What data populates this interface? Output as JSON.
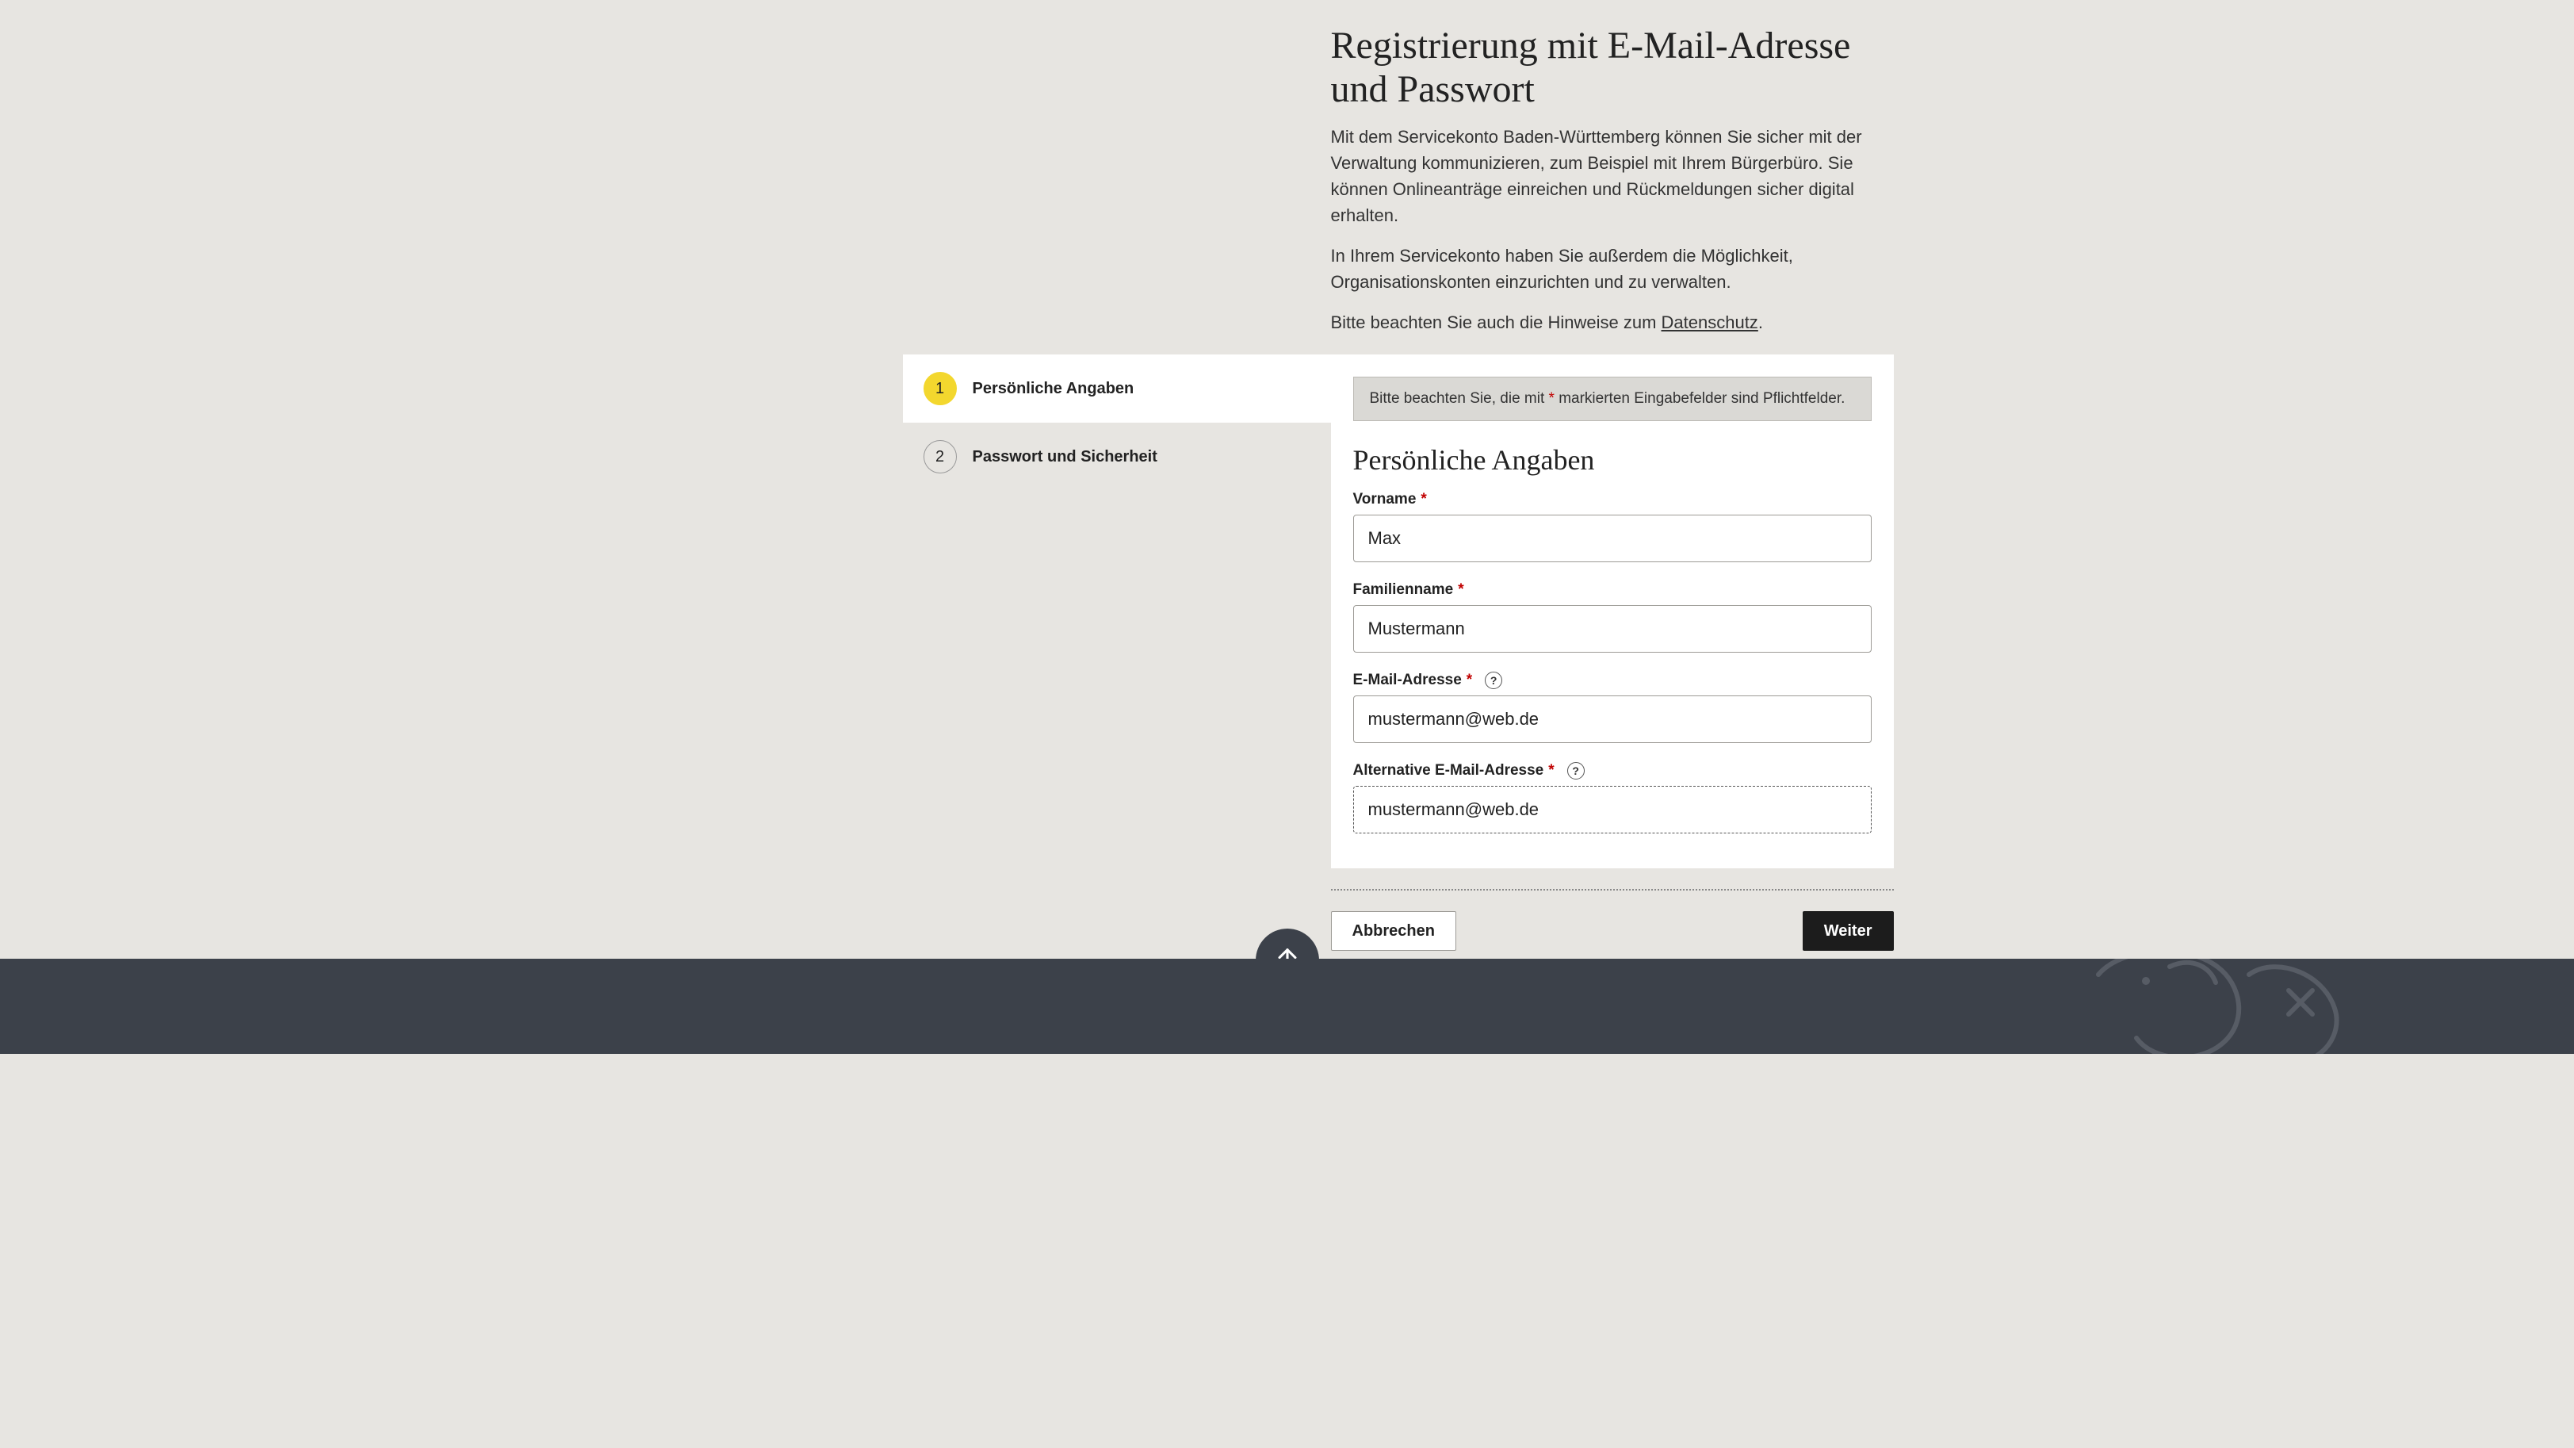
{
  "page": {
    "title": "Registrierung mit E-Mail-Adresse und Passwort",
    "intro1": "Mit dem Servicekonto Baden-Württemberg können Sie sicher mit der Verwaltung kommunizieren, zum Beispiel mit Ihrem Bürgerbüro. Sie können Onlineanträge einreichen und Rückmeldungen sicher digital erhalten.",
    "intro2": "In Ihrem Servicekonto haben Sie außerdem die Möglichkeit, Organisationskonten einzurichten und zu verwalten.",
    "privacy_prefix": "Bitte beachten Sie auch die Hinweise zum ",
    "privacy_link": "Datenschutz",
    "privacy_suffix": "."
  },
  "steps": [
    {
      "num": "1",
      "label": "Persönliche Angaben",
      "active": true
    },
    {
      "num": "2",
      "label": "Passwort und Sicherheit",
      "active": false
    }
  ],
  "notice": {
    "before": "Bitte beachten Sie, die mit ",
    "mark": "*",
    "after": " markierten Eingabefelder sind Pflichtfelder."
  },
  "form": {
    "section_title": "Persönliche Angaben",
    "firstname_label": "Vorname",
    "firstname_value": "Max",
    "lastname_label": "Familienname",
    "lastname_value": "Mustermann",
    "email_label": "E-Mail-Adresse",
    "email_value": "mustermann@web.de",
    "altemail_label": "Alternative E-Mail-Adresse",
    "altemail_value": "mustermann@web.de",
    "required_mark": "*",
    "help_glyph": "?"
  },
  "actions": {
    "cancel": "Abbrechen",
    "next": "Weiter"
  }
}
